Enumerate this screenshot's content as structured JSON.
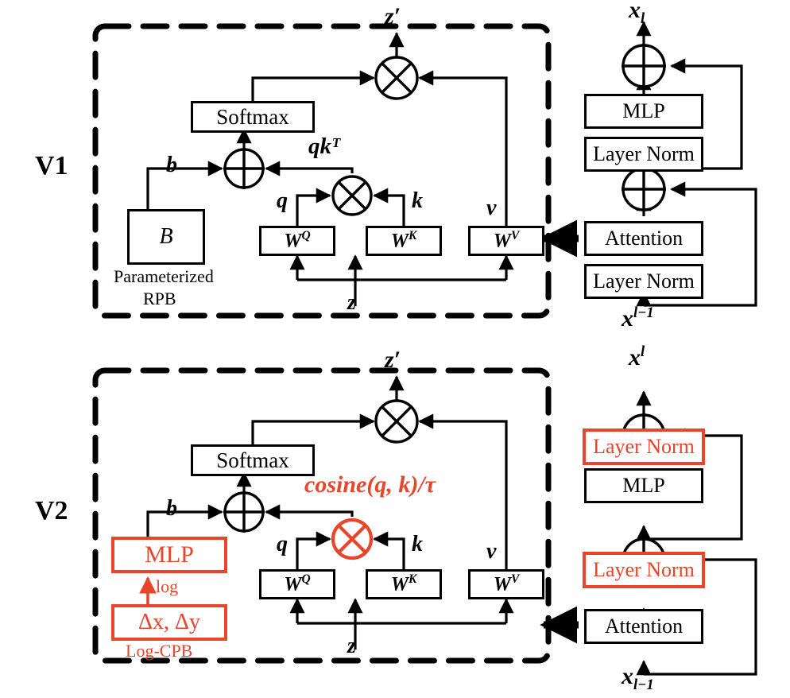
{
  "figure": {
    "title": "Swin Transformer V1 vs V2 attention block comparison",
    "accent_red": "#E8452B",
    "ink": "#000000"
  },
  "rows": [
    {
      "id": "v1",
      "version_label": "V1",
      "attention_detail": {
        "output_label": "z′",
        "softmax_label": "Softmax",
        "score_label": "qkᵀ",
        "bias_label": "b",
        "bias_box_label": "B",
        "bias_caption_line1": "Parameterized",
        "bias_caption_line2": "RPB",
        "q_label": "q",
        "k_label": "k",
        "v_label": "v",
        "wq_label": "W",
        "wq_sup": "Q",
        "wk_label": "W",
        "wk_sup": "K",
        "wv_label": "W",
        "wv_sup": "V",
        "input_label": "z",
        "mul_icon": "circle-times-icon",
        "add_icon": "circle-plus-icon"
      },
      "block": {
        "top_label": "x",
        "top_label_sub": "l",
        "top_label_sup": "",
        "bottom_label": "x",
        "bottom_label_sub": "",
        "bottom_label_sup": "l−1",
        "stack": [
          {
            "label": "MLP",
            "red": false
          },
          {
            "label": "Layer Norm",
            "red": false
          },
          {
            "label": "Attention",
            "red": false
          },
          {
            "label": "Layer Norm",
            "red": false
          }
        ]
      }
    },
    {
      "id": "v2",
      "version_label": "V2",
      "attention_detail": {
        "output_label": "z′",
        "softmax_label": "Softmax",
        "score_label": "cosine(q, k)/τ",
        "bias_label": "b",
        "mlp_label": "MLP",
        "log_label": "log",
        "delta_label": "Δx, Δy",
        "bias_caption_line1": "Log-CPB",
        "q_label": "q",
        "k_label": "k",
        "v_label": "v",
        "wq_label": "W",
        "wq_sup": "Q",
        "wk_label": "W",
        "wk_sup": "K",
        "wv_label": "W",
        "wv_sup": "V",
        "input_label": "z",
        "mul_icon": "circle-times-icon",
        "add_icon": "circle-plus-icon"
      },
      "block": {
        "top_label": "x",
        "top_label_sub": "",
        "top_label_sup": "l",
        "bottom_label": "x",
        "bottom_label_sub": "l−1",
        "bottom_label_sup": "",
        "stack": [
          {
            "label": "Layer Norm",
            "red": true
          },
          {
            "label": "MLP",
            "red": false
          },
          {
            "label": "Layer Norm",
            "red": true
          },
          {
            "label": "Attention",
            "red": false
          }
        ]
      }
    }
  ]
}
